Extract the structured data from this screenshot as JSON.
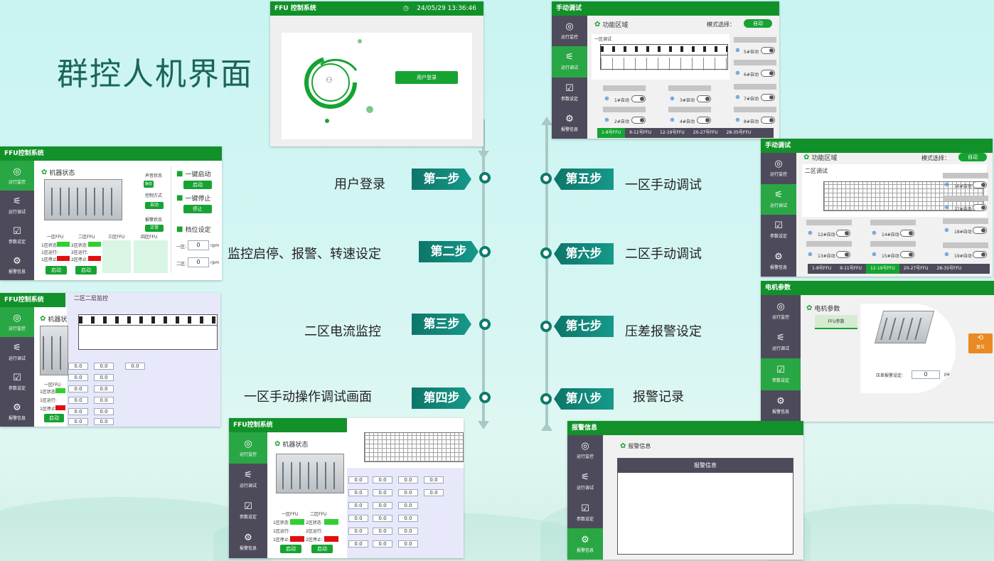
{
  "page_title": "群控人机界面",
  "login_window": {
    "title": "FFU 控制系统",
    "clock": "24/05/29 13:36:46",
    "login_button": "用户登录"
  },
  "status_window": {
    "title": "FFU控制系统",
    "section": "机器状态",
    "sound_label": "声音状态",
    "sound_value": "静音",
    "ctrl_label": "控制方式",
    "ctrl_value": "自动",
    "alarm_label": "报警状态",
    "alarm_value": "正常",
    "start_title": "一键启动",
    "start_btn": "启动",
    "stop_title": "一键停止",
    "stop_btn": "停止",
    "gear_title": "档位设定",
    "gear_rows": [
      {
        "label": "一区:",
        "value": "0",
        "unit": "rpm"
      },
      {
        "label": "二区:",
        "value": "0",
        "unit": "rpm"
      }
    ],
    "zones": [
      "一区FFU",
      "二区FFU",
      "三区FFU",
      "四区FFU"
    ],
    "zone_state_1": [
      "1区状态",
      "1区运行:",
      "1区停止:"
    ],
    "zone_state_2": [
      "2区状态",
      "2区运行:",
      "2区停止:"
    ],
    "ok": "正常",
    "start_small": "启动"
  },
  "monitor_window": {
    "title": "FFU控制系统",
    "section": "机器状",
    "panel_title": "二区二层监控",
    "zone": "一区FFU",
    "state_lines": [
      "1区状态",
      "1区运行:",
      "1区停止:"
    ],
    "start_small": "启动",
    "readings": [
      "0.0",
      "0.0",
      "0.0",
      "0.0",
      "0.0",
      "0.0",
      "0.0",
      "0.0",
      "0.0",
      "0.0",
      "0.0",
      "0.0",
      "0.0"
    ],
    "column_numbers": [
      "11",
      "10",
      "9",
      "8",
      "7",
      "6",
      "5",
      "4",
      "3",
      "2",
      "1"
    ]
  },
  "manual_window_2": {
    "title": "FFU控制系统",
    "section": "机器状态",
    "zones": [
      "一区FFU",
      "二区FFU"
    ],
    "state_lines_1": [
      "1区状态",
      "1区运行:",
      "1区停止:"
    ],
    "state_lines_2": [
      "2区状态",
      "2区运行:",
      "2区停止:"
    ],
    "ok": "正常",
    "start_small": "启动",
    "numbers_top": [
      "22",
      "20",
      "19",
      "18",
      "12",
      "14",
      "12",
      "16",
      "15",
      "13"
    ],
    "numbers_bottom": [
      "31",
      "30",
      "29",
      "28",
      "27",
      "26",
      "25",
      "24"
    ],
    "readings": [
      "0.0",
      "0.0",
      "0.0",
      "0.0",
      "0.0",
      "0.0",
      "0.0",
      "0.0",
      "0.0",
      "0.0",
      "0.0",
      "0.0",
      "0.0",
      "0.0",
      "0.0",
      "0.0",
      "0.0",
      "0.0",
      "0.0",
      "0.0"
    ]
  },
  "zone1_debug": {
    "title": "手动调试",
    "section": "功能区域",
    "mode_label": "模式选择：",
    "mode_value": "自动",
    "panel": "一区调试",
    "col_numbers": [
      "11",
      "10",
      "9",
      "8",
      "7",
      "6",
      "5",
      "4",
      "3",
      "2",
      "1"
    ],
    "ffu_rows": [
      "1#自动",
      "2#自动",
      "3#自动",
      "4#自动"
    ],
    "right_rows": [
      "5#自动",
      "6#自动",
      "7#自动",
      "8#自动"
    ],
    "tabs": [
      "1-8号FFU",
      "9-11号FFU",
      "12-19号FFU",
      "20-27号FFU",
      "28-35号FFU"
    ],
    "active_tab": 0
  },
  "zone2_debug": {
    "title": "手动调试",
    "section": "功能区域",
    "mode_label": "模式选择：",
    "mode_value": "自动",
    "panel": "二区调试",
    "ffu_rows": [
      "12#自动",
      "13#自动",
      "14#自动",
      "15#自动"
    ],
    "right_rows": [
      "16#自动",
      "17#自动",
      "18#自动",
      "19#自动"
    ],
    "numbers_top": [
      "22",
      "20",
      "19",
      "18",
      "17",
      "14",
      "12",
      "16",
      "15",
      "13"
    ],
    "numbers_bottom": [
      "34",
      "33",
      "31",
      "30",
      "29",
      "28",
      "27",
      "26",
      "25",
      "24"
    ],
    "tabs": [
      "1-8号FFU",
      "9-11号FFU",
      "12-19号FFU",
      "20-27号FFU",
      "28-35号FFU"
    ],
    "active_tab": 2
  },
  "motor_window": {
    "title": "电机参数",
    "section": "电机参数",
    "ffu_btn": "FFU参数",
    "pressure_label": "压差报警设定:",
    "pressure_value": "0",
    "unit": "pa",
    "reset": "复位"
  },
  "alarm_window": {
    "title": "报警信息",
    "section": "报警信息",
    "table_header": "报警信息"
  },
  "sidebar": [
    "运行监控",
    "运行调试",
    "参数设定",
    "报警信息"
  ],
  "steps": [
    {
      "label": "第一步",
      "desc": "用户登录"
    },
    {
      "label": "第二步",
      "desc": "监控启停、报警、转速设定"
    },
    {
      "label": "第三步",
      "desc": "二区电流监控"
    },
    {
      "label": "第四步",
      "desc": "一区手动操作调试画面"
    },
    {
      "label": "第五步",
      "desc": "一区手动调试"
    },
    {
      "label": "第六步",
      "desc": "二区手动调试"
    },
    {
      "label": "第七步",
      "desc": "压差报警设定"
    },
    {
      "label": "第八步",
      "desc": "报警记录"
    }
  ],
  "colors": {
    "accent": "#12912a",
    "teal": "#0f7a6c",
    "sidebar": "#4d4b5b",
    "alarm_red": "#e01010"
  }
}
